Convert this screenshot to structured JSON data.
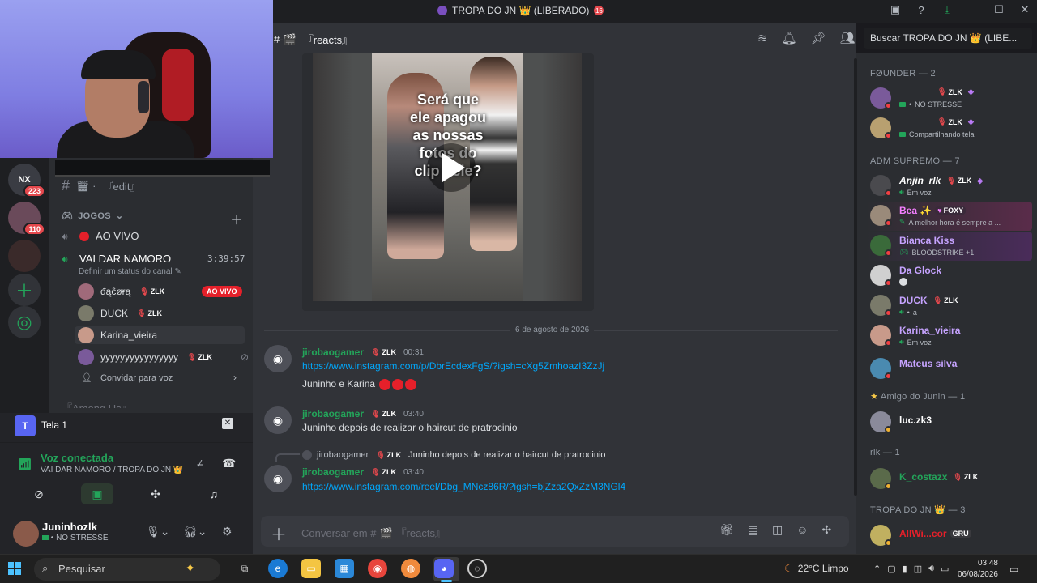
{
  "window": {
    "title": "TROPA DO JN 👑 (LIBERADO)",
    "title_badge": "16"
  },
  "channel_header": {
    "name_icon": "#-🎬",
    "name": "『reacts』",
    "search_placeholder": "Buscar TROPA DO JN 👑 (LIBE..."
  },
  "servers": [
    {
      "label": "NX",
      "badge": "223"
    },
    {
      "label": "",
      "badge": "110"
    },
    {
      "label": "",
      "badge": ""
    }
  ],
  "sidebar": {
    "text_channel": "『edit』",
    "category": "JOGOS",
    "voice_channels": [
      {
        "name": "AO VIVO",
        "live_dot": true
      },
      {
        "name": "VAI DAR NAMORO",
        "timer": "3:39:57",
        "status_hint": "Definir um status do canal"
      }
    ],
    "voice_members": [
      {
        "name": "đąĉøɍą",
        "tag": "ZLK",
        "live": "AO VIVO"
      },
      {
        "name": "DUCK",
        "tag": "ZLK"
      },
      {
        "name": "Karina_vieira",
        "tag": ""
      },
      {
        "name": "yyyyyyyyyyyyyyyy",
        "tag": "ZLK"
      }
    ],
    "invite": "Convidar para voz",
    "next_channel": "『Among Us』"
  },
  "screen_share": {
    "icon_letter": "T",
    "label": "Tela 1"
  },
  "voice_panel": {
    "title": "Voz conectada",
    "subtitle": "VAI DAR NAMORO / TROPA DO JN 👑 (..."
  },
  "user_panel": {
    "name": "Juninhozlk",
    "status": "NO STRESSE"
  },
  "video": {
    "overlay_text": "Será que ele apagou as nossas fotos do clip dele?"
  },
  "date_divider": "6 de agosto de 2026",
  "messages": [
    {
      "author": "jirobaogamer",
      "tag": "ZLK",
      "time": "00:31",
      "lines": [
        "https://www.instagram.com/p/DbrEcdexFgS/?igsh=cXg5ZmhoazI3ZzJj",
        "Juninho e Karina"
      ]
    },
    {
      "author": "jirobaogamer",
      "tag": "ZLK",
      "time": "03:40",
      "lines": [
        "Juninho depois de realizar o haircut de pratrocinio"
      ]
    },
    {
      "reply_author": "jirobaogamer",
      "reply_tag": "ZLK",
      "reply_text": "Juninho depois de realizar o haircut de pratrocinio",
      "author": "jirobaogamer",
      "tag": "ZLK",
      "time": "03:40",
      "lines": [
        "https://www.instagram.com/reel/Dbg_MNcz86R/?igsh=bjZza2QxZzM3NGl4"
      ]
    }
  ],
  "composer": {
    "placeholder": "Conversar em #-🎬 『reacts』"
  },
  "members": {
    "sections": [
      {
        "title": "FØUNDER — 2"
      },
      {
        "title": "ADM SUPREMO — 7"
      },
      {
        "title": "Amigo do Junin — 1"
      },
      {
        "title": "rlk — 1"
      },
      {
        "title": "TROPA DO JN 👑 — 3"
      }
    ],
    "founder": [
      {
        "name": "",
        "tag": "ZLK",
        "sub": "NO STRESSE"
      },
      {
        "name": "",
        "tag": "ZLK",
        "sub": "Compartilhando tela"
      }
    ],
    "adm": [
      {
        "name": "Anjin_rlk",
        "tag": "ZLK",
        "sub": "Em voz",
        "color": "#ffffff"
      },
      {
        "name": "Bea ✨",
        "tag": "FOXY",
        "sub": "A melhor hora é sempre a ...",
        "color": "#f47fff"
      },
      {
        "name": "Bianca Kiss",
        "tag": "",
        "sub": "BLOODSTRIKE +1",
        "color": "#c6a3ff"
      },
      {
        "name": "Da Glock",
        "tag": "",
        "sub": "",
        "color": "#c6a3ff"
      },
      {
        "name": "DUCK",
        "tag": "ZLK",
        "sub": "a",
        "color": "#c6a3ff"
      },
      {
        "name": "Karina_vieira",
        "tag": "",
        "sub": "Em voz",
        "color": "#c6a3ff"
      },
      {
        "name": "Mateus silva",
        "tag": "",
        "sub": "",
        "color": "#c6a3ff"
      }
    ],
    "amigo": [
      {
        "name": "luc.zk3",
        "color": "#ffffff"
      }
    ],
    "rlk": [
      {
        "name": "K_costazx",
        "tag": "ZLK",
        "color": "#23a55a"
      }
    ],
    "tropa": [
      {
        "name": "AllWi...cor",
        "tag": "GRU",
        "color": "#e5202a"
      }
    ]
  },
  "taskbar": {
    "search": "Pesquisar",
    "weather": "22°C Limpo",
    "time": "03:48",
    "date": "06/08/2026"
  }
}
